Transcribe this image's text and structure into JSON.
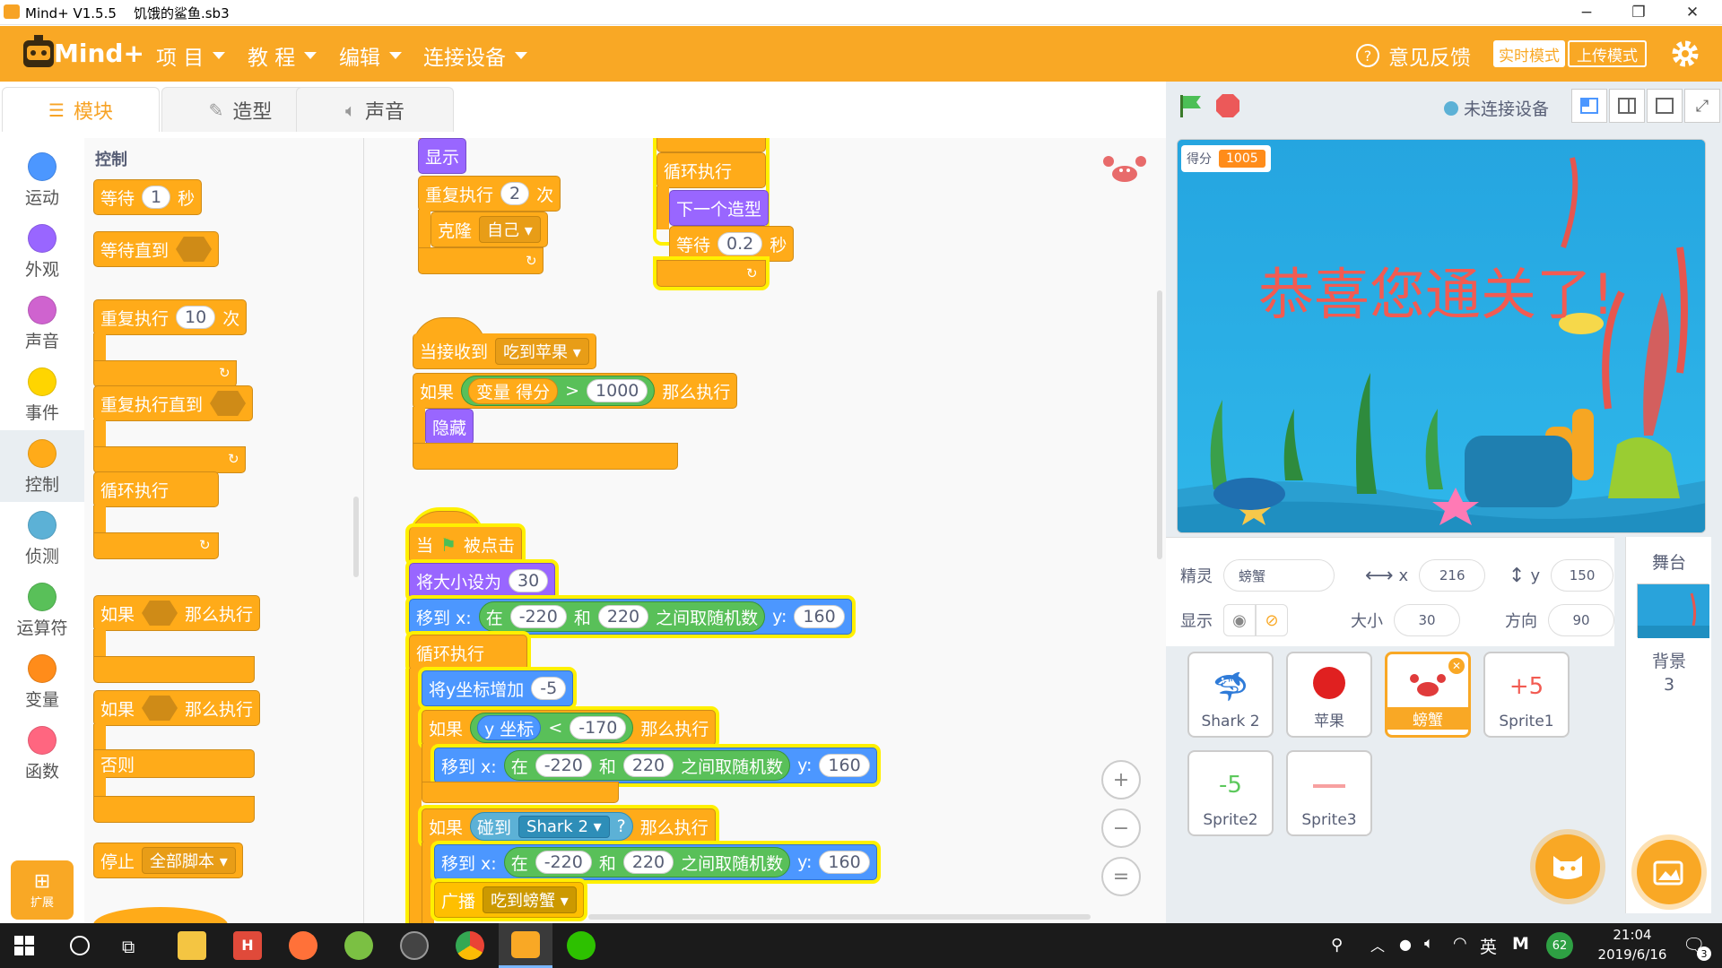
{
  "window": {
    "title": "Mind+ V1.5.5    饥饿的鲨鱼.sb3",
    "minimize": "−",
    "restore": "❐",
    "close": "✕"
  },
  "menubar": {
    "logo_text": "Mind+",
    "items": [
      "项 目",
      "教 程",
      "编辑",
      "连接设备"
    ],
    "feedback": "意见反馈",
    "mode_realtime": "实时模式",
    "mode_upload": "上传模式",
    "brand_color": "#f9a825"
  },
  "tabs": [
    {
      "label": "模块",
      "icon": "blocks-icon"
    },
    {
      "label": "造型",
      "icon": "brush-icon"
    },
    {
      "label": "声音",
      "icon": "speaker-icon"
    }
  ],
  "stage_header": {
    "connection": "未连接设备"
  },
  "categories": [
    {
      "label": "运动",
      "color": "#4c97ff"
    },
    {
      "label": "外观",
      "color": "#9966ff"
    },
    {
      "label": "声音",
      "color": "#cf63cf"
    },
    {
      "label": "事件",
      "color": "#ffd500"
    },
    {
      "label": "控制",
      "color": "#ffab19"
    },
    {
      "label": "侦测",
      "color": "#5cb1d6"
    },
    {
      "label": "运算符",
      "color": "#59c059"
    },
    {
      "label": "变量",
      "color": "#ff8c1a"
    },
    {
      "label": "函数",
      "color": "#ff6680"
    }
  ],
  "extensions": {
    "label": "扩展"
  },
  "palette": {
    "title": "控制",
    "wait": {
      "label": "等待",
      "value": "1",
      "unit": "秒"
    },
    "wait_until": {
      "label": "等待直到"
    },
    "repeat": {
      "label": "重复执行",
      "value": "10",
      "unit": "次"
    },
    "repeat_until": {
      "label": "重复执行直到"
    },
    "forever": {
      "label": "循环执行"
    },
    "if_then": {
      "label": "如果",
      "then": "那么执行"
    },
    "if_else": {
      "label": "如果",
      "then": "那么执行",
      "else": "否则"
    },
    "stop": {
      "label": "停止",
      "option": "全部脚本"
    }
  },
  "scripts": {
    "s1": {
      "show": "显示",
      "repeat": "重复执行",
      "repeat_n": "2",
      "repeat_unit": "次",
      "clone": "克隆",
      "clone_target": "自己"
    },
    "s2": {
      "forever": "循环执行",
      "next_costume": "下一个造型",
      "wait": "等待",
      "wait_val": "0.2",
      "wait_unit": "秒"
    },
    "s3": {
      "when_receive": "当接收到",
      "message": "吃到苹果",
      "if": "如果",
      "var": "变量",
      "var_name": "得分",
      "op": ">",
      "value": "1000",
      "then": "那么执行",
      "hide": "隐藏"
    },
    "s4": {
      "when": "当",
      "clicked": "被点击",
      "set_size": "将大小设为",
      "size": "30",
      "goto_x": "移到 x:",
      "rand_in": "在",
      "rand_from": "-220",
      "rand_and": "和",
      "rand_to": "220",
      "rand_end": "之间取随机数",
      "y_label": "y:",
      "y_val": "160",
      "forever": "循环执行",
      "change_y": "将y坐标增加",
      "change_y_val": "-5",
      "if": "如果",
      "y_pos": "y 坐标",
      "lt": "<",
      "lt_val": "-170",
      "then": "那么执行",
      "touching": "碰到",
      "touch_target": "Shark 2",
      "qmark": "?",
      "broadcast": "广播",
      "broadcast_msg": "吃到螃蟹"
    }
  },
  "zoom": {
    "in": "+",
    "out": "−",
    "reset": "="
  },
  "stage": {
    "score_label": "得分",
    "score_value": "1005",
    "congrats": "恭喜您通关了!"
  },
  "sprite_info": {
    "sprite_label": "精灵",
    "sprite_name": "螃蟹",
    "x_label": "x",
    "x_val": "216",
    "y_label": "y",
    "y_val": "150",
    "show_label": "显示",
    "size_label": "大小",
    "size_val": "30",
    "dir_label": "方向",
    "dir_val": "90"
  },
  "sprites": [
    {
      "name": "Shark 2",
      "icon": "shark-icon"
    },
    {
      "name": "苹果",
      "icon": "apple-icon"
    },
    {
      "name": "螃蟹",
      "icon": "crab-icon",
      "selected": true
    },
    {
      "name": "Sprite1",
      "icon": "plus5-icon",
      "glyph": "+5"
    },
    {
      "name": "Sprite2",
      "icon": "minus5-icon",
      "glyph": "-5"
    },
    {
      "name": "Sprite3",
      "icon": "congrats-icon"
    }
  ],
  "stage_panel": {
    "title": "舞台",
    "backdrop_label": "背景",
    "backdrop_count": "3"
  },
  "taskbar": {
    "time": "21:04",
    "date": "2019/6/16",
    "lang": "英",
    "battery": "62",
    "notif": "3"
  }
}
